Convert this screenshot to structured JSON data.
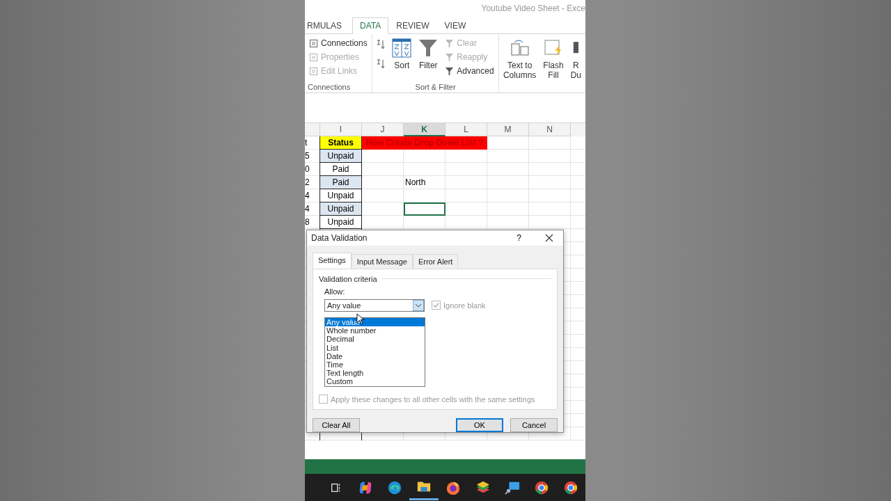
{
  "window": {
    "title": "Youtube Video Sheet - Exce"
  },
  "ribbon_tabs": [
    {
      "label": "RMULAS",
      "selected": false
    },
    {
      "label": "DATA",
      "selected": true
    },
    {
      "label": "REVIEW",
      "selected": false
    },
    {
      "label": "VIEW",
      "selected": false
    }
  ],
  "ribbon": {
    "connections": {
      "items": [
        {
          "label": "Connections",
          "disabled": false
        },
        {
          "label": "Properties",
          "disabled": true
        },
        {
          "label": "Edit Links",
          "disabled": true
        }
      ],
      "group_label": "Connections"
    },
    "sort_filter": {
      "sort": "Sort",
      "filter": "Filter",
      "items": [
        {
          "label": "Clear",
          "disabled": true
        },
        {
          "label": "Reapply",
          "disabled": true
        },
        {
          "label": "Advanced",
          "disabled": false
        }
      ],
      "group_label": "Sort & Filter"
    },
    "data_tools": [
      {
        "lines": [
          "Text to",
          "Columns"
        ],
        "kind": "text_to_columns"
      },
      {
        "lines": [
          "Flash",
          "Fill"
        ],
        "kind": "flash_fill"
      },
      {
        "lines": [
          "R",
          "Du"
        ],
        "kind": "remove_duplicates"
      }
    ]
  },
  "sheet": {
    "columns": [
      {
        "label": "I",
        "selected": false
      },
      {
        "label": "J",
        "selected": false
      },
      {
        "label": "K",
        "selected": true
      },
      {
        "label": "L",
        "selected": false
      },
      {
        "label": "M",
        "selected": false
      },
      {
        "label": "N",
        "selected": false
      }
    ],
    "rows": [
      {
        "kind": "header",
        "column_h": "t",
        "status": "Status",
        "banner": "How Create Drop Down List ?"
      },
      {
        "kind": "data",
        "column_h": "5",
        "status": "Unpaid",
        "shaded": true,
        "k_selected": false
      },
      {
        "kind": "data",
        "column_h": "0",
        "status": "Paid",
        "shaded": false,
        "k_selected": false
      },
      {
        "kind": "data",
        "column_h": "2",
        "status": "Paid",
        "shaded": true,
        "column_k": "North",
        "k_selected": false
      },
      {
        "kind": "data",
        "column_h": "4",
        "status": "Unpaid",
        "shaded": false,
        "k_selected": false
      },
      {
        "kind": "data",
        "column_h": "4",
        "status": "Unpaid",
        "shaded": true,
        "k_selected": true
      },
      {
        "kind": "data",
        "column_h": "8",
        "status": "Unpaid",
        "shaded": false,
        "k_selected": false
      }
    ]
  },
  "dialog": {
    "title": "Data Validation",
    "help": "?",
    "tabs": [
      {
        "label": "Settings",
        "selected": true
      },
      {
        "label": "Input Message",
        "selected": false
      },
      {
        "label": "Error Alert",
        "selected": false
      }
    ],
    "section": "Validation criteria",
    "allow_label": "Allow:",
    "allow_value": "Any value",
    "options": [
      {
        "label": "Any value",
        "selected": true
      },
      {
        "label": "Whole number",
        "selected": false
      },
      {
        "label": "Decimal",
        "selected": false
      },
      {
        "label": "List",
        "selected": false
      },
      {
        "label": "Date",
        "selected": false
      },
      {
        "label": "Time",
        "selected": false
      },
      {
        "label": "Text length",
        "selected": false
      },
      {
        "label": "Custom",
        "selected": false
      }
    ],
    "ignore_blank": {
      "label": "Ignore blank",
      "checked": true,
      "disabled": true
    },
    "apply_all": {
      "label": "Apply these changes to all other cells with the same settings",
      "checked": false,
      "disabled": true
    },
    "buttons": [
      {
        "label": "Clear All",
        "kind": "left",
        "default": false
      },
      {
        "label": "OK",
        "kind": "right",
        "default": true
      },
      {
        "label": "Cancel",
        "kind": "right",
        "default": false
      }
    ]
  },
  "taskbar": [
    {
      "kind": "taskview"
    },
    {
      "kind": "copilot"
    },
    {
      "kind": "edge"
    },
    {
      "kind": "folder",
      "selected": true
    },
    {
      "kind": "firefox"
    },
    {
      "kind": "layers"
    },
    {
      "kind": "monitor"
    },
    {
      "kind": "chrome_profile"
    },
    {
      "kind": "chrome"
    }
  ]
}
